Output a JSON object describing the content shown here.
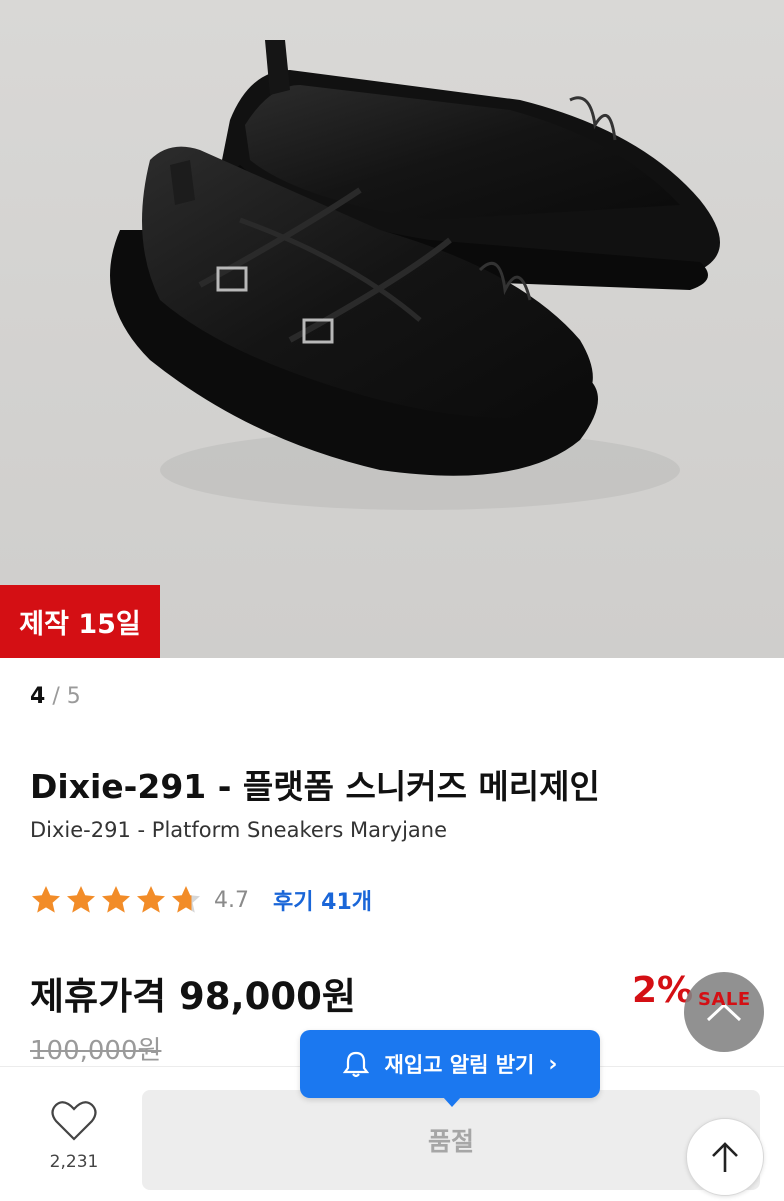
{
  "product": {
    "badge": "제작 15일",
    "pager": {
      "current": "4",
      "separator": "/",
      "total": "5"
    },
    "title_ko": "Dixie-291 - 플랫폼 스니커즈 메리제인",
    "title_en": "Dixie-291 - Platform Sneakers Maryjane",
    "rating": {
      "value": 4.7,
      "value_label": "4.7",
      "stars_max": 5,
      "reviews_label": "후기 41개",
      "star_color": "#f28c28"
    },
    "price": "제휴가격 98,000원",
    "discount": "2%",
    "sale_label": "SALE",
    "original_price": "100,000원",
    "image_icon": "product-photo"
  },
  "restock": {
    "label": "재입고 알림 받기",
    "chevron": "›",
    "icon": "bell-icon",
    "color": "#1b78f0"
  },
  "bottom": {
    "wishlist_count": "2,231",
    "wishlist_icon": "heart-icon",
    "soldout_label": "품절",
    "scroll_icon": "arrow-up-icon"
  },
  "colors": {
    "accent_red": "#d40f14",
    "link_blue": "#1a66d8"
  }
}
